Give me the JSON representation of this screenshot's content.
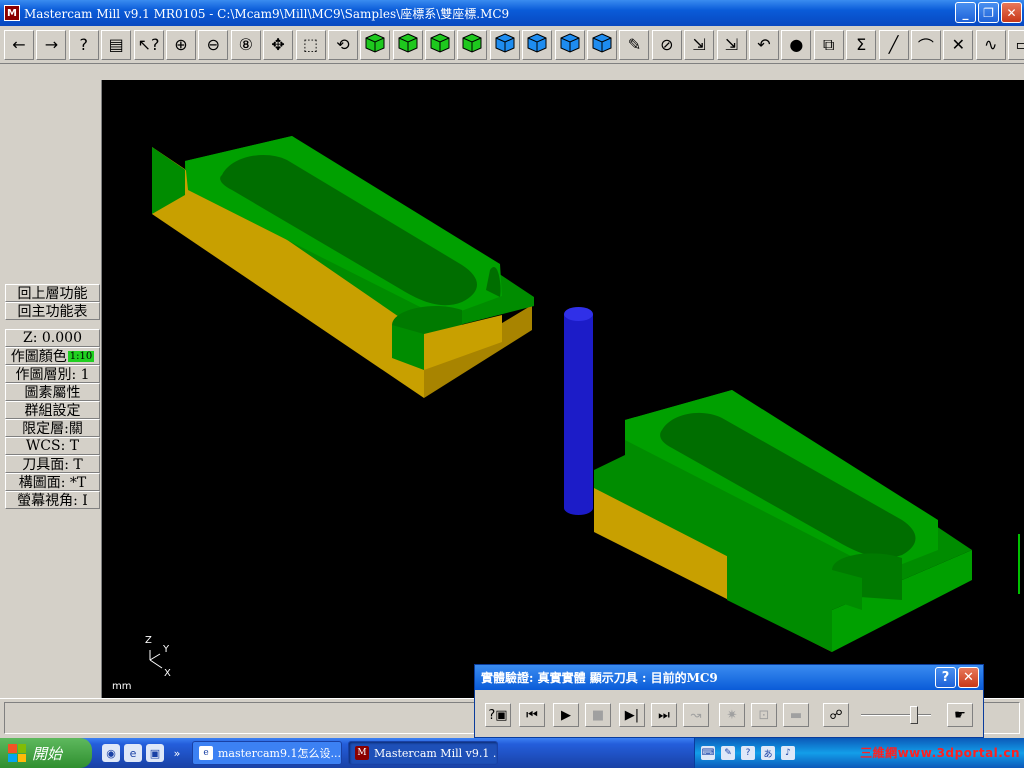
{
  "window": {
    "title": "Mastercam Mill v9.1 MR0105 - C:\\Mcam9\\Mill\\MC9\\Samples\\座標系\\雙座標.MC9",
    "icon": "mastercam-app-icon",
    "minimize": "_",
    "restore": "❐",
    "close": "✕"
  },
  "toolbar": {
    "buttons": [
      {
        "name": "prev-menu-button",
        "icon": "arrow-left-icon",
        "glyph": "←"
      },
      {
        "name": "next-menu-button",
        "icon": "arrow-right-icon",
        "glyph": "→"
      },
      {
        "name": "help-button",
        "icon": "help-icon",
        "glyph": "?"
      },
      {
        "name": "calculator-button",
        "icon": "calculator-icon",
        "glyph": "▤"
      },
      {
        "name": "analyze-button",
        "icon": "analyze-icon",
        "glyph": "↖?"
      },
      {
        "name": "zoom-button",
        "icon": "zoom-icon",
        "glyph": "⊕"
      },
      {
        "name": "unzoom-button",
        "icon": "unzoom-icon",
        "glyph": "⊖"
      },
      {
        "name": "zoom-8-button",
        "icon": "zoom-8-icon",
        "glyph": "⑧"
      },
      {
        "name": "pan-button",
        "icon": "pan-icon",
        "glyph": "✥"
      },
      {
        "name": "fit-button",
        "icon": "fit-icon",
        "glyph": "⬚"
      },
      {
        "name": "rotate-button",
        "icon": "rotate-icon",
        "glyph": "⟲"
      },
      {
        "name": "view-top-button",
        "icon": "view-cube-top-icon",
        "glyph": ""
      },
      {
        "name": "view-front-button",
        "icon": "view-cube-front-icon",
        "glyph": ""
      },
      {
        "name": "view-side-button",
        "icon": "view-cube-side-icon",
        "glyph": ""
      },
      {
        "name": "view-iso-button",
        "icon": "view-cube-iso-icon",
        "glyph": ""
      },
      {
        "name": "cplane-top-button",
        "icon": "cplane-cube-top-icon",
        "glyph": ""
      },
      {
        "name": "cplane-front-button",
        "icon": "cplane-cube-front-icon",
        "glyph": ""
      },
      {
        "name": "cplane-side-button",
        "icon": "cplane-cube-side-icon",
        "glyph": ""
      },
      {
        "name": "cplane-3d-button",
        "icon": "cplane-cube-3d-icon",
        "glyph": ""
      },
      {
        "name": "screen-clear-button",
        "icon": "eraser-icon",
        "glyph": "✎"
      },
      {
        "name": "delete-button",
        "icon": "delete-icon",
        "glyph": "⊘"
      },
      {
        "name": "xform-button",
        "icon": "xform-icon",
        "glyph": "⇲"
      },
      {
        "name": "xform-color-button",
        "icon": "xform-color-icon",
        "glyph": "⇲"
      },
      {
        "name": "undo-button",
        "icon": "undo-icon",
        "glyph": "↶"
      },
      {
        "name": "shade-button",
        "icon": "sphere-icon",
        "glyph": "●"
      },
      {
        "name": "group-button",
        "icon": "group-icon",
        "glyph": "⧉"
      },
      {
        "name": "sum-button",
        "icon": "sigma-icon",
        "glyph": "Σ"
      },
      {
        "name": "line-button",
        "icon": "line-icon",
        "glyph": "╱"
      },
      {
        "name": "arc-button",
        "icon": "arc-icon",
        "glyph": "⌒"
      },
      {
        "name": "fillet-button",
        "icon": "fillet-icon",
        "glyph": "✕"
      },
      {
        "name": "spline-button",
        "icon": "spline-icon",
        "glyph": "∿"
      },
      {
        "name": "rectangle-button",
        "icon": "rectangle-icon",
        "glyph": "▭"
      }
    ]
  },
  "sidebar": {
    "items": [
      {
        "label": "回上層功能"
      },
      {
        "label": "回主功能表"
      },
      {
        "label": "Z:  0.000"
      },
      {
        "label": "作圖顏色",
        "chip": "1:10"
      },
      {
        "label": "作圖層別:  1"
      },
      {
        "label": "圖素屬性"
      },
      {
        "label": "群組設定"
      },
      {
        "label": "限定層:關"
      },
      {
        "label": "WCS:   T"
      },
      {
        "label": "刀具面:  T"
      },
      {
        "label": "構圖面:  *T"
      },
      {
        "label": "螢幕視角:  I"
      }
    ]
  },
  "viewport": {
    "units": "mm",
    "axis_labels": {
      "z": "Z",
      "y": "Y",
      "x": "X"
    },
    "colors": {
      "top": "#008c00",
      "top_dark": "#006e00",
      "side": "#c8a000",
      "side_dark": "#a88400",
      "tool": "#1c1cc8",
      "background": "#000000"
    }
  },
  "dialog": {
    "title": "實體驗證: 真實實體 顯示刀具 : 目前的MC9",
    "help": "?",
    "close": "✕",
    "controls": [
      {
        "name": "options-button",
        "glyph": "?▣",
        "dim": false
      },
      {
        "name": "rewind-button",
        "glyph": "⏮",
        "dim": false
      },
      {
        "name": "play-button",
        "glyph": "▶",
        "dim": false
      },
      {
        "name": "stop-button",
        "glyph": "■",
        "dim": true
      },
      {
        "name": "step-button",
        "glyph": "▶|",
        "dim": false
      },
      {
        "name": "fast-forward-button",
        "glyph": "⏭",
        "dim": false
      },
      {
        "name": "toolpath-button",
        "glyph": "↝",
        "dim": true
      },
      {
        "name": "collision-button",
        "glyph": "✷",
        "dim": true
      },
      {
        "name": "zoom-dialog-button",
        "glyph": "⊡",
        "dim": true
      },
      {
        "name": "folder-button",
        "glyph": "▬",
        "dim": true
      },
      {
        "name": "walk-button",
        "glyph": "☍",
        "dim": false
      },
      {
        "name": "speed-button",
        "glyph": "☛",
        "dim": false
      }
    ],
    "speed": 0.75
  },
  "taskbar": {
    "start": "開始",
    "tasks": [
      {
        "label": "mastercam9.1怎么设...",
        "active": false
      },
      {
        "label": "Mastercam Mill v9.1 ...",
        "active": true
      }
    ],
    "watermark": "三維網www.3dportal.cn"
  }
}
